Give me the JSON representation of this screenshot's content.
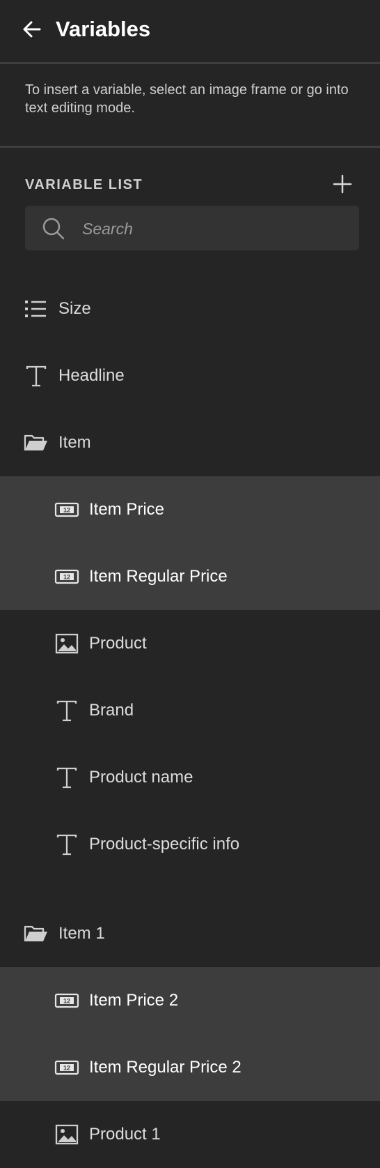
{
  "header": {
    "title": "Variables"
  },
  "hint": "To insert a variable, select an image frame or go into text editing mode.",
  "variable_list": {
    "label": "VARIABLE LIST",
    "search_placeholder": "Search"
  },
  "items": [
    {
      "label": "Size",
      "icon": "list-icon",
      "level": 0,
      "highlighted": false
    },
    {
      "label": "Headline",
      "icon": "text-icon",
      "level": 0,
      "highlighted": false
    },
    {
      "label": "Item",
      "icon": "folder-open-icon",
      "level": 0,
      "highlighted": false
    },
    {
      "label": "Item Price",
      "icon": "number-icon",
      "level": 1,
      "highlighted": true
    },
    {
      "label": "Item Regular Price",
      "icon": "number-icon",
      "level": 1,
      "highlighted": true
    },
    {
      "label": "Product",
      "icon": "image-icon",
      "level": 1,
      "highlighted": false
    },
    {
      "label": "Brand",
      "icon": "text-icon",
      "level": 1,
      "highlighted": false
    },
    {
      "label": "Product name",
      "icon": "text-icon",
      "level": 1,
      "highlighted": false
    },
    {
      "label": "Product-specific info",
      "icon": "text-icon",
      "level": 1,
      "highlighted": false
    },
    {
      "label": "Item 1",
      "icon": "folder-open-icon",
      "level": 0,
      "highlighted": false
    },
    {
      "label": "Item Price 2",
      "icon": "number-icon",
      "level": 1,
      "highlighted": true
    },
    {
      "label": "Item Regular Price 2",
      "icon": "number-icon",
      "level": 1,
      "highlighted": true
    },
    {
      "label": "Product 1",
      "icon": "image-icon",
      "level": 1,
      "highlighted": false
    }
  ],
  "number_icon_text": "12",
  "colors": {
    "background": "#252525",
    "highlight": "#3d3d3d",
    "divider": "#3e3e3e",
    "search_bg": "#333333"
  }
}
